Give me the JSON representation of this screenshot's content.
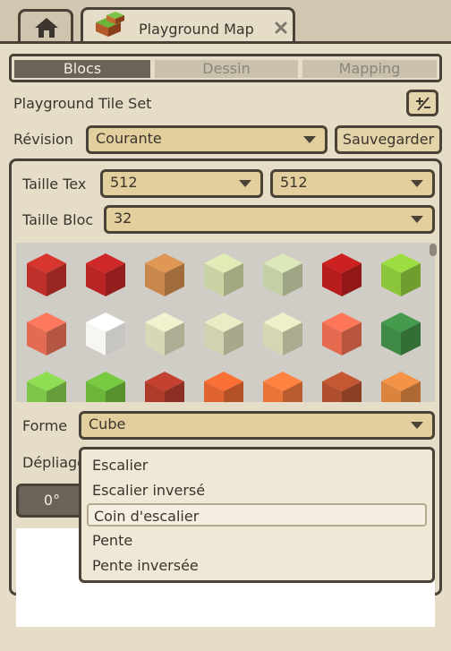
{
  "tabs": {
    "home_icon": "home-icon",
    "title": "Playground Map",
    "tile_icon": "tiles-icon",
    "close_icon": "close-icon"
  },
  "segmented": {
    "items": [
      "Blocs",
      "Dessin",
      "Mapping"
    ],
    "active": "Blocs"
  },
  "tileset": {
    "title": "Playground Tile Set",
    "expand_icon": "plus-minus-icon"
  },
  "revision": {
    "label": "Révision",
    "value": "Courante",
    "save_label": "Sauvegarder"
  },
  "texture": {
    "label": "Taille Tex",
    "value1": "512",
    "value2": "512"
  },
  "bloc": {
    "label": "Taille Bloc",
    "value": "32"
  },
  "tiles": [
    {
      "name": "roof-tile",
      "color": "#c0302a"
    },
    {
      "name": "red-block",
      "color": "#b92424"
    },
    {
      "name": "stool",
      "color": "#c9874b"
    },
    {
      "name": "pale-green-block",
      "color": "#c9d3a3"
    },
    {
      "name": "light-green-block",
      "color": "#c5cfa6"
    },
    {
      "name": "red-slab",
      "color": "#b71d1d"
    },
    {
      "name": "flower-grass-block",
      "color": "#8bc63a"
    },
    {
      "name": "salmon-block",
      "color": "#e26b52"
    },
    {
      "name": "white-block",
      "color": "#f8f6f2"
    },
    {
      "name": "brick-block-1",
      "color": "#d7d8b8"
    },
    {
      "name": "brick-block-2",
      "color": "#d2d2b0"
    },
    {
      "name": "brick-block-3",
      "color": "#d5d6b3"
    },
    {
      "name": "salmon-block-2",
      "color": "#e56a4f"
    },
    {
      "name": "green-stripe-block",
      "color": "#3e8a44"
    },
    {
      "name": "grass-tuft",
      "color": "#7ec64a"
    },
    {
      "name": "leaf-block",
      "color": "#6bb53a"
    },
    {
      "name": "red-brick-block",
      "color": "#b03a2a"
    },
    {
      "name": "orange-white-block",
      "color": "#e0642f"
    },
    {
      "name": "orange-white-block-2",
      "color": "#e9743a"
    },
    {
      "name": "wood-block-dark",
      "color": "#b04f2d"
    },
    {
      "name": "wood-block-light",
      "color": "#d9833f"
    }
  ],
  "shape": {
    "label": "Forme",
    "value": "Cube"
  },
  "unfold": {
    "label": "Dépliage"
  },
  "rotation": {
    "value": "0°"
  },
  "dropdown": {
    "options": [
      "Escalier",
      "Escalier inversé",
      "Coin d'escalier",
      "Pente",
      "Pente inversée"
    ],
    "highlighted": "Coin d'escalier"
  }
}
